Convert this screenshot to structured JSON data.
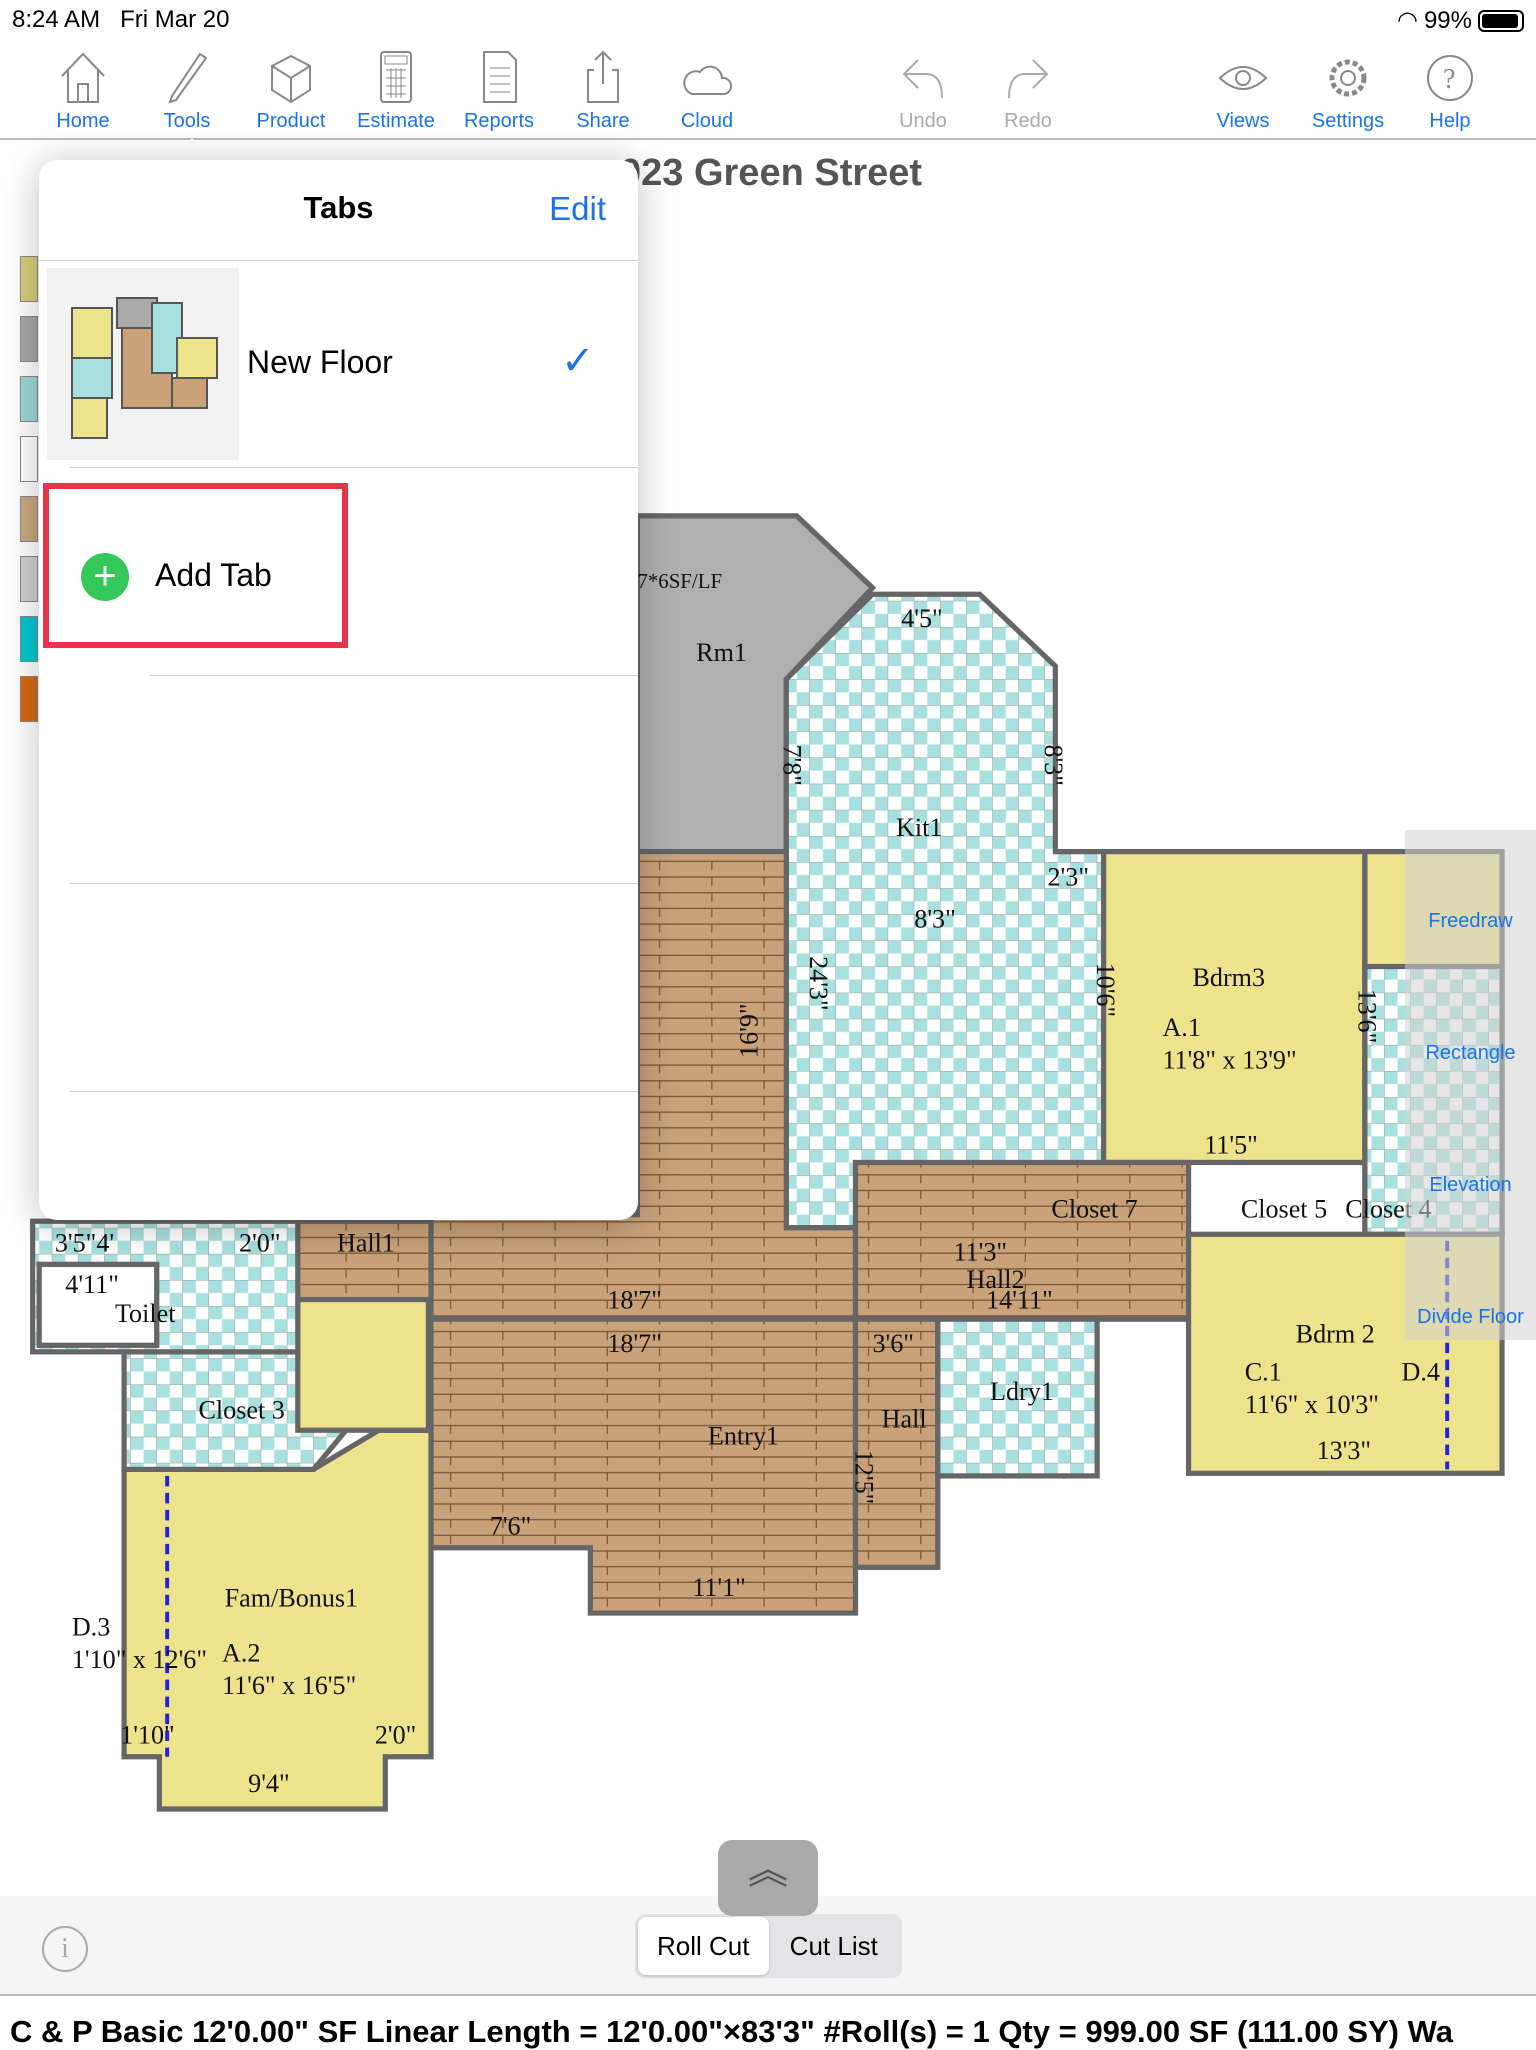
{
  "status": {
    "time": "8:24 AM",
    "date": "Fri Mar 20",
    "battery": "99%"
  },
  "toolbar": {
    "items": [
      {
        "label": "Home",
        "icon": "house-icon"
      },
      {
        "label": "Tools",
        "icon": "pencil-icon"
      },
      {
        "label": "Product",
        "icon": "box-icon"
      },
      {
        "label": "Estimate",
        "icon": "calculator-icon"
      },
      {
        "label": "Reports",
        "icon": "document-icon"
      },
      {
        "label": "Share",
        "icon": "share-icon"
      },
      {
        "label": "Cloud",
        "icon": "cloud-icon"
      },
      {
        "label": "Undo",
        "icon": "undo-icon",
        "disabled": true
      },
      {
        "label": "Redo",
        "icon": "redo-icon",
        "disabled": true
      },
      {
        "label": "Views",
        "icon": "eye-icon"
      },
      {
        "label": "Settings",
        "icon": "gear-icon"
      },
      {
        "label": "Help",
        "icon": "help-icon"
      }
    ]
  },
  "project": {
    "title": "023 Green Street"
  },
  "swatches": [
    "#d9cd7a",
    "#a8a8a8",
    "#9fd8d8",
    "#ffffff",
    "#c8a880",
    "#cfcfcf",
    "#00c8d0",
    "#d86a10"
  ],
  "popover": {
    "title": "Tabs",
    "edit": "Edit",
    "tabs": [
      {
        "label": "New Floor",
        "selected": true
      }
    ],
    "add_tab": "Add Tab"
  },
  "plan": {
    "labels": [
      "Rm1",
      "7*6SF/LF",
      "Kit1",
      "Bdrm3",
      "A.1",
      "11'8\" x 13'9\"",
      "11'5\"",
      "Bdrm 2",
      "C.1",
      "11'6\" x 10'3\"",
      "D.4",
      "13'3\"",
      "Hall2",
      "14'11\"",
      "11'3\"",
      "Entry1",
      "18'7\"",
      "18'7\"",
      "11'1\"",
      "Hall",
      "Ldry1",
      "Fam/Bonus1",
      "A.2",
      "11'6\" x 16'5\"",
      "D.3",
      "1'10\" x 12'6\"",
      "9'4\"",
      "Closet 3",
      "Hall1",
      "Toilet",
      "Closet 7",
      "Closet 5",
      "Closet 4",
      "16'9\"",
      "24'3\"",
      "10'6\"",
      "13'6\"",
      "4'5\"",
      "8'3\"",
      "7'8\"",
      "2'3\"",
      "8'3\"",
      "3'5\"4'",
      "4'11\"",
      "2'0\"",
      "2'0\"",
      "1'10\"",
      "12'5\"",
      "7'6\"",
      "3'6\""
    ]
  },
  "side_tools": [
    "Freedraw",
    "Rectangle",
    "Elevation",
    "Divide Floor"
  ],
  "bottom": {
    "segments": [
      "Roll Cut",
      "Cut List"
    ],
    "selected": "Roll Cut",
    "info": "i",
    "footer": "C & P Basic 12'0.00\" SF   Linear Length = 12'0.00\"×83'3\"   #Roll(s) = 1   Qty = 999.00 SF (111.00 SY)   Wa"
  }
}
